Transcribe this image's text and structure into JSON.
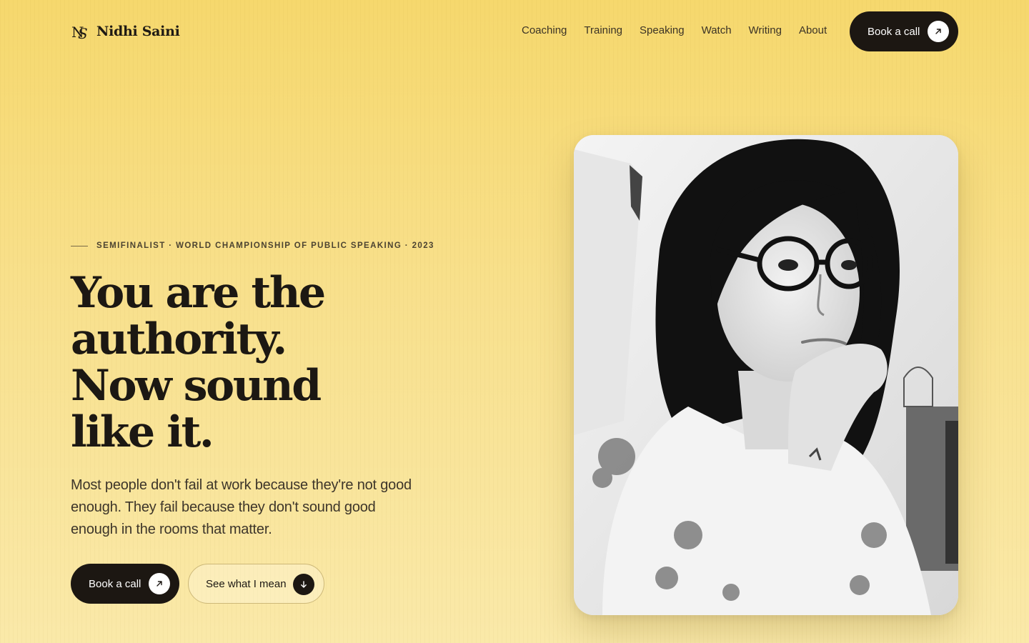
{
  "brand": {
    "monogram": "NS",
    "name": "Nidhi Saini"
  },
  "nav": {
    "items": [
      {
        "label": "Coaching"
      },
      {
        "label": "Training"
      },
      {
        "label": "Speaking"
      },
      {
        "label": "Watch"
      },
      {
        "label": "Writing"
      },
      {
        "label": "About"
      }
    ],
    "cta_label": "Book a call",
    "cta_icon": "arrow-up-right-icon"
  },
  "hero": {
    "eyebrow": "SEMIFINALIST · WORLD CHAMPIONSHIP OF PUBLIC SPEAKING · 2023",
    "headline_lines": [
      "You are the",
      "authority.",
      "Now sound",
      "like it."
    ],
    "lede": "Most people don't fail at work because they're not good enough. They fail because they don't sound good enough in the rooms that matter.",
    "primary_cta": {
      "label": "Book a call",
      "icon": "arrow-up-right-icon"
    },
    "secondary_cta": {
      "label": "See what I mean",
      "icon": "arrow-down-icon"
    }
  },
  "portrait": {
    "description_icon": "portrait-photo"
  },
  "colors": {
    "background_top": "#f6d86d",
    "background_bottom": "#fae9a9",
    "ink": "#1c1813",
    "button_dark": "#1c1712"
  }
}
